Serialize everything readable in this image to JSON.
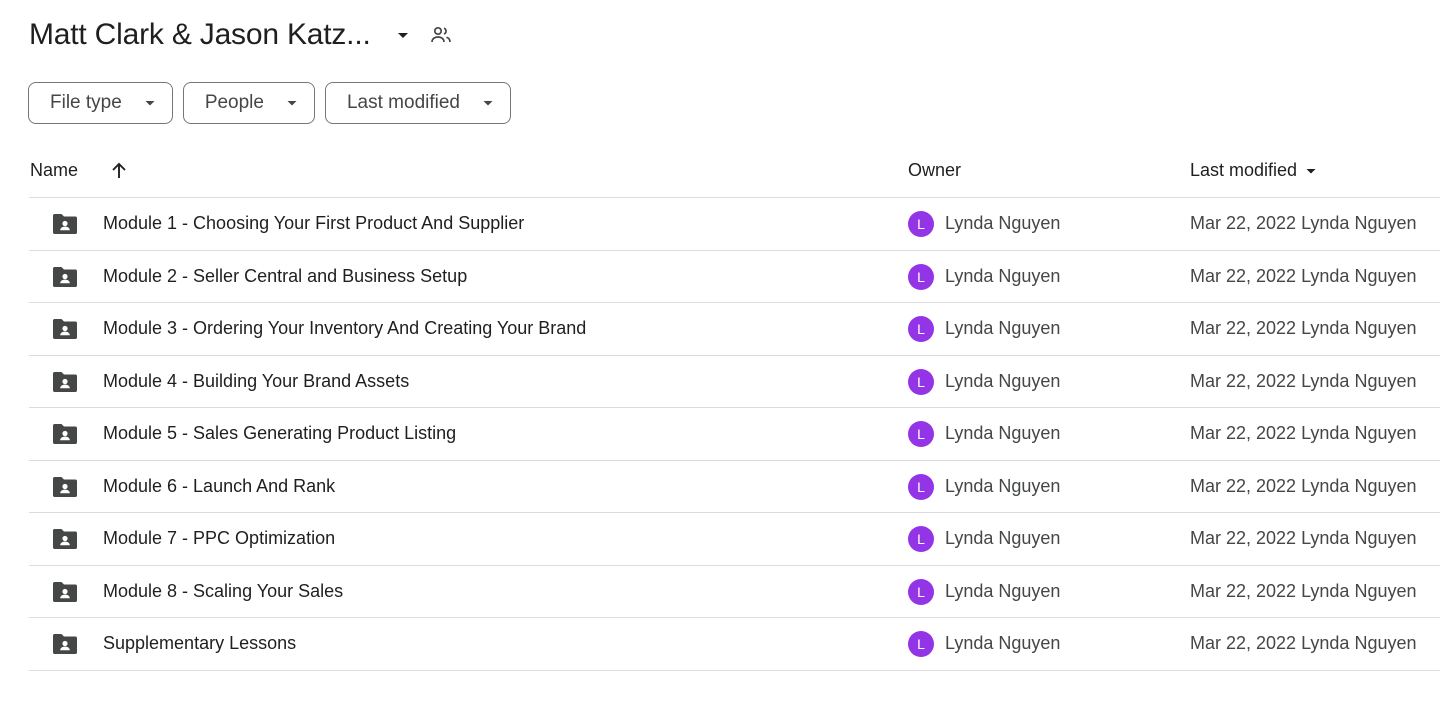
{
  "header": {
    "title": "Matt Clark & Jason Katz...",
    "caret_icon": "arrow-drop-down-icon",
    "shared_icon": "people-shared-icon"
  },
  "filters": [
    {
      "label": "File type"
    },
    {
      "label": "People"
    },
    {
      "label": "Last modified"
    }
  ],
  "table": {
    "columns": {
      "name": "Name",
      "owner": "Owner",
      "last_modified": "Last modified"
    },
    "sort_icon": "arrow-upward-icon",
    "rows": [
      {
        "name": "Module 1 - Choosing Your First Product And Supplier",
        "owner": "Lynda Nguyen",
        "avatar": "L",
        "modified": "Mar 22, 2022 Lynda Nguyen"
      },
      {
        "name": "Module 2 - Seller Central and Business Setup",
        "owner": "Lynda Nguyen",
        "avatar": "L",
        "modified": "Mar 22, 2022 Lynda Nguyen"
      },
      {
        "name": "Module 3 - Ordering Your Inventory And Creating Your Brand",
        "owner": "Lynda Nguyen",
        "avatar": "L",
        "modified": "Mar 22, 2022 Lynda Nguyen"
      },
      {
        "name": "Module 4 - Building Your Brand Assets",
        "owner": "Lynda Nguyen",
        "avatar": "L",
        "modified": "Mar 22, 2022 Lynda Nguyen"
      },
      {
        "name": "Module 5 - Sales Generating Product Listing",
        "owner": "Lynda Nguyen",
        "avatar": "L",
        "modified": "Mar 22, 2022 Lynda Nguyen"
      },
      {
        "name": "Module 6 - Launch And Rank",
        "owner": "Lynda Nguyen",
        "avatar": "L",
        "modified": "Mar 22, 2022 Lynda Nguyen"
      },
      {
        "name": "Module 7 - PPC Optimization",
        "owner": "Lynda Nguyen",
        "avatar": "L",
        "modified": "Mar 22, 2022 Lynda Nguyen"
      },
      {
        "name": "Module 8 - Scaling Your Sales",
        "owner": "Lynda Nguyen",
        "avatar": "L",
        "modified": "Mar 22, 2022 Lynda Nguyen"
      },
      {
        "name": "Supplementary Lessons",
        "owner": "Lynda Nguyen",
        "avatar": "L",
        "modified": "Mar 22, 2022 Lynda Nguyen"
      }
    ]
  },
  "colors": {
    "avatar_bg": "#9334e6",
    "divider": "#dadce0",
    "icon": "#444746"
  }
}
